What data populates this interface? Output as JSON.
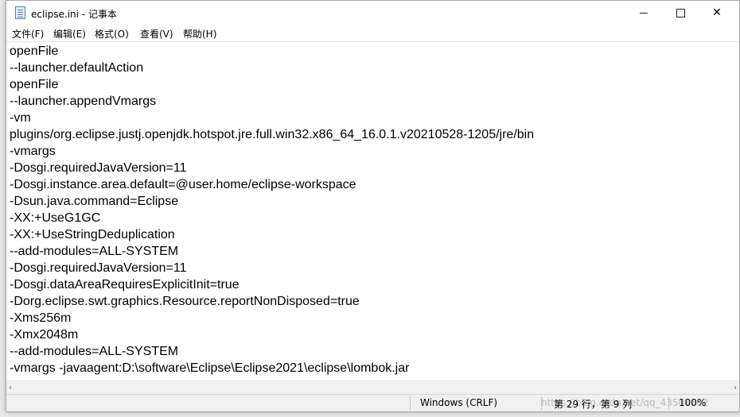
{
  "window": {
    "title": "eclipse.ini - 记事本",
    "controls": {
      "minimize": "",
      "maximize": "",
      "close": "✕"
    }
  },
  "menu": [
    "文件(F)",
    "编辑(E)",
    "格式(O)",
    "查看(V)",
    "帮助(H)"
  ],
  "content_lines": [
    "openFile",
    "--launcher.defaultAction",
    "openFile",
    "--launcher.appendVmargs",
    "-vm",
    "plugins/org.eclipse.justj.openjdk.hotspot.jre.full.win32.x86_64_16.0.1.v20210528-1205/jre/bin",
    "-vmargs",
    "-Dosgi.requiredJavaVersion=11",
    "-Dosgi.instance.area.default=@user.home/eclipse-workspace",
    "-Dsun.java.command=Eclipse",
    "-XX:+UseG1GC",
    "-XX:+UseStringDeduplication",
    "--add-modules=ALL-SYSTEM",
    "-Dosgi.requiredJavaVersion=11",
    "-Dosgi.dataAreaRequiresExplicitInit=true",
    "-Dorg.eclipse.swt.graphics.Resource.reportNonDisposed=true",
    "-Xms256m",
    "-Xmx2048m",
    "--add-modules=ALL-SYSTEM",
    "-vmargs -javaagent:D:\\software\\Eclipse\\Eclipse2021\\eclipse\\lombok.jar"
  ],
  "scrollbar": {
    "left": "‹",
    "right": "›"
  },
  "status": {
    "encoding": "Windows (CRLF)",
    "position": "第 29 行，第 9 列",
    "zoom": "100%",
    "watermark": "https://blog.csdn.net/qq_43508802"
  }
}
